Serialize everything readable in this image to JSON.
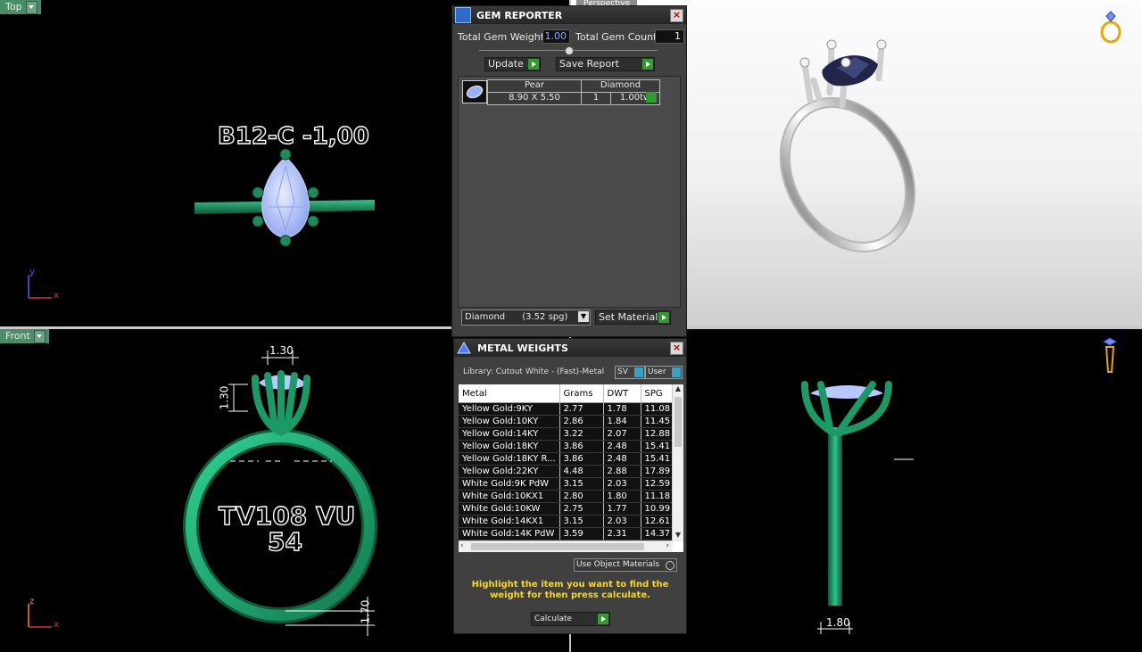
{
  "viewports": {
    "top": {
      "label": "Top",
      "annotation": "B12-C -1,00",
      "axes": {
        "vertical": "y",
        "horizontal": "x"
      }
    },
    "perspective": {
      "label": "Perspective"
    },
    "front": {
      "label": "Front",
      "dim_top": "1.30",
      "dim_side": "1.30",
      "text_line1": "TV108 VU",
      "text_line2": "54",
      "dim_bottom": "1.70",
      "axes": {
        "vertical": "z",
        "horizontal": "x"
      }
    },
    "right": {
      "dim_bottom": "1.80"
    }
  },
  "gem_reporter": {
    "title": "GEM REPORTER",
    "total_weight_label": "Total Gem Weight",
    "total_weight_value": "1.00",
    "total_count_label": "Total Gem Count",
    "total_count_value": "1",
    "update_label": "Update",
    "save_report_label": "Save Report",
    "gems": [
      {
        "shape": "Pear",
        "size": "8.90 X 5.50",
        "material": "Diamond",
        "count": "1",
        "weight": "1.00tw"
      }
    ],
    "material_select": "Diamond      (3.52 spg)",
    "set_material_label": "Set Material"
  },
  "metal_weights": {
    "title": "METAL WEIGHTS",
    "library": "Library: Cutout White - (Fast)-Metal",
    "sv_label": "SV",
    "user_label": "User",
    "columns": [
      "Metal",
      "Grams",
      "DWT",
      "SPG"
    ],
    "rows": [
      [
        "Yellow Gold:9KY",
        "2.77",
        "1.78",
        "11.08"
      ],
      [
        "Yellow Gold:10KY",
        "2.86",
        "1.84",
        "11.45"
      ],
      [
        "Yellow Gold:14KY",
        "3.22",
        "2.07",
        "12.88"
      ],
      [
        "Yellow Gold:18KY",
        "3.86",
        "2.48",
        "15.41"
      ],
      [
        "Yellow Gold:18KY R...",
        "3.86",
        "2.48",
        "15.41"
      ],
      [
        "Yellow Gold:22KY",
        "4.48",
        "2.88",
        "17.89"
      ],
      [
        "White Gold:9K PdW",
        "3.15",
        "2.03",
        "12.59"
      ],
      [
        "White Gold:10KX1",
        "2.80",
        "1.80",
        "11.18"
      ],
      [
        "White Gold:10KW",
        "2.75",
        "1.77",
        "10.99"
      ],
      [
        "White Gold:14KX1",
        "3.15",
        "2.03",
        "12.61"
      ],
      [
        "White Gold:14K PdW",
        "3.59",
        "2.31",
        "14.37"
      ]
    ],
    "use_object_materials": "Use Object Materials",
    "hint": "Highlight the item you want to find the weight for then press calculate.",
    "calculate_label": "Calculate"
  },
  "colors": {
    "ring_green": "#1f9e6a",
    "gem_blue": "#b8c8ff",
    "cad_bg": "#000000",
    "panel_bg": "#404040",
    "hint_yellow": "#ffd800"
  }
}
